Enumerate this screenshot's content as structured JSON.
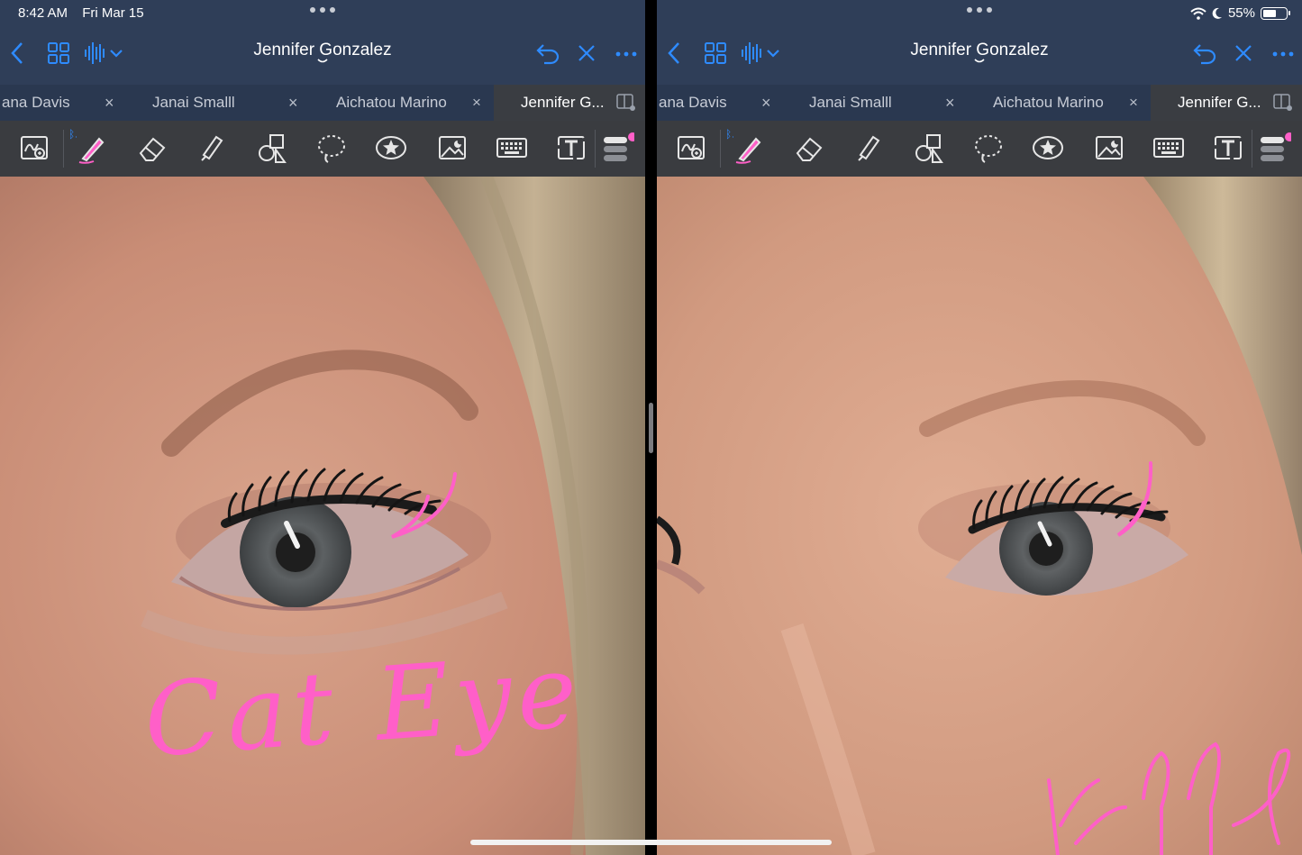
{
  "status": {
    "time": "8:42 AM",
    "date": "Fri Mar 15",
    "battery": "55%",
    "battery_level": 0.55
  },
  "left_pane": {
    "title": "Jennifer Gonzalez",
    "tabs": [
      {
        "label": "ana Davis",
        "active": false
      },
      {
        "label": "Janai Smalll",
        "active": false
      },
      {
        "label": "Aichatou Marino",
        "active": false
      },
      {
        "label": "Jennifer G...",
        "active": true
      }
    ],
    "annotation": "Cat Eye"
  },
  "right_pane": {
    "title": "Jennifer Gonzalez",
    "tabs": [
      {
        "label": "ana Davis",
        "active": false
      },
      {
        "label": "Janai Smalll",
        "active": false
      },
      {
        "label": "Aichatou Marino",
        "active": false
      },
      {
        "label": "Jennifer G...",
        "active": true
      }
    ]
  },
  "tools": [
    "zoom-handwriting",
    "pen",
    "eraser",
    "highlighter",
    "shapes",
    "lasso",
    "sticker",
    "image",
    "keyboard",
    "text",
    "tool-settings"
  ],
  "colors": {
    "navbar": "#2f3e58",
    "toolbar": "#3a3c40",
    "accent": "#2e8bff",
    "ink": "#ff5fc8"
  }
}
